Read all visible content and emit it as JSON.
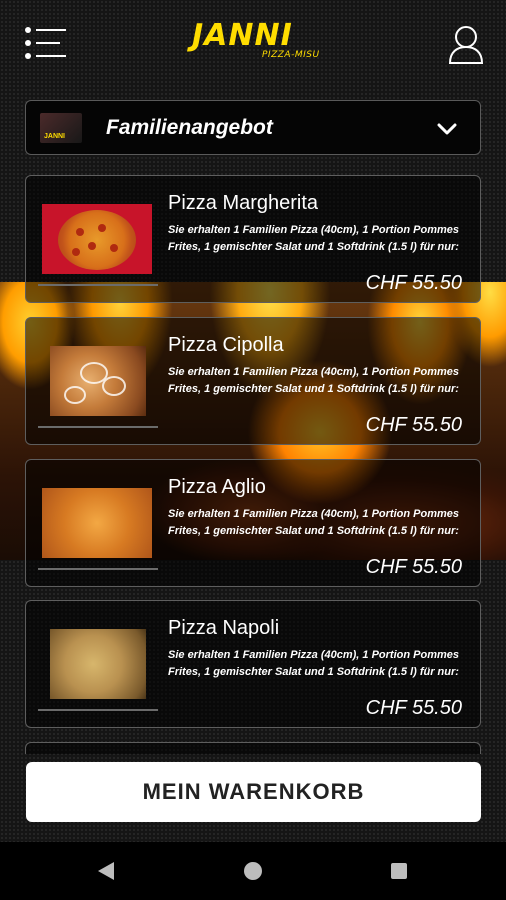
{
  "header": {
    "logo_main": "JANNI",
    "logo_sub": "PIZZA-MISU",
    "menu_icon": "hamburger-menu-icon",
    "user_icon": "user-icon"
  },
  "category": {
    "label": "Familienangebot",
    "thumb_text": "JANNI",
    "chevron_icon": "chevron-down-icon"
  },
  "products": [
    {
      "name": "Pizza Margherita",
      "description": "Sie erhalten 1 Familien Pizza (40cm), 1 Portion Pommes Frites, 1 gemischter Salat und 1 Softdrink (1.5 l) für nur:",
      "price": "CHF 55.50"
    },
    {
      "name": "Pizza Cipolla",
      "description": "Sie erhalten 1 Familien Pizza (40cm), 1 Portion Pommes Frites, 1 gemischter Salat und 1 Softdrink (1.5 l) für nur:",
      "price": "CHF 55.50"
    },
    {
      "name": "Pizza Aglio",
      "description": "Sie erhalten 1 Familien Pizza (40cm), 1 Portion Pommes Frites, 1 gemischter Salat und 1 Softdrink (1.5 l) für nur:",
      "price": "CHF 55.50"
    },
    {
      "name": "Pizza Napoli",
      "description": "Sie erhalten 1 Familien Pizza (40cm), 1 Portion Pommes Frites, 1 gemischter Salat und 1 Softdrink (1.5 l) für nur:",
      "price": "CHF 55.50"
    }
  ],
  "cart": {
    "label": "MEIN WARENKORB"
  },
  "navbar": {
    "back_icon": "back-triangle-icon",
    "home_icon": "home-circle-icon",
    "recent_icon": "recent-apps-square-icon"
  },
  "colors": {
    "accent": "#ffdd00",
    "background": "#151515",
    "card_border": "#5e5e5e",
    "button_bg": "#ffffff"
  }
}
